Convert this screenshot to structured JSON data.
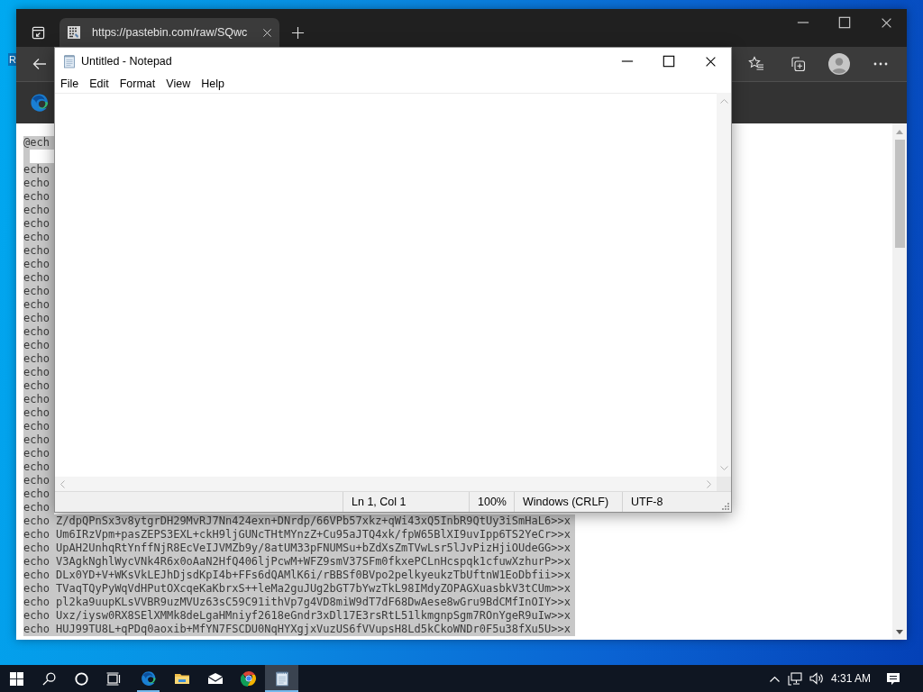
{
  "desktop": {
    "icon_labels": [
      "R"
    ]
  },
  "browser": {
    "tabs": [
      {
        "title": "https://pastebin.com/raw/SQwc",
        "selected": true
      }
    ],
    "page": {
      "selected": true,
      "first_line": "@ech",
      "lines": [
        "echo",
        "echo",
        "echo",
        "echo",
        "echo",
        "echo",
        "echo",
        "echo",
        "echo",
        "echo",
        "echo",
        "echo",
        "echo",
        "echo",
        "echo",
        "echo",
        "echo",
        "echo",
        "echo",
        "echo",
        "echo",
        "echo",
        "echo",
        "echo",
        "echo",
        "echo",
        "echo Z/dpQPnSx3v8ytgrDH29MvRJ7Nn424exn+DNrdp/66VPb57xkz+qWi43xQ5InbR9QtUy3iSmHaL6>>x",
        "echo Um6IRzVpm+pasZEPS3EXL+ckH9ljGUNcTHtMYnzZ+Cu95aJTQ4xk/fpW65BlXI9uvIpp6TS2YeCr>>x",
        "echo UpAH2UnhqRtYnffNjR8EcVeIJVMZb9y/8atUM33pFNUMSu+bZdXsZmTVwLsr5lJvPizHjiOUdeGG>>x",
        "echo V3AgkNghlWycVNk4R6x0oAaN2HfQ406ljPcwM+WFZ9smV37SFm0fkxePCLnHcspqk1cfuwXzhurP>>x",
        "echo DLx0YD+V+WKsVkLEJhDjsdKpI4b+FFs6dQAMlK6i/rBBSf0BVpo2pelkyeukzTbUftnW1EoDbfii>>x",
        "echo TVaqTQyPyWqVdHPutOXcqeKaKbrxS++leMa2guJUg2bGT7bYwzTkL98IMdyZOPAGXuasbkV3tCUm>>x",
        "echo pl2ka9uupKLsVVBR9uzMVUz63sC59C91ithVp7g4VD8miW9dT7dF68DwAese8wGru9BdCMfInOIY>>x",
        "echo Uxz/iysw0RX8SElXMMk8deLgaHMniyf2618eGndr3xDl17E3rsRtL51lkmgnpSgm7ROnYgeR9uIw>>x",
        "echo HUJ99TU8L+qPDq0aoxib+MfYN7FSCDU0NqHYXgjxVuzUS6fVVupsH8Ld5kCkoWNDr0F5u38fXu5U>>x"
      ]
    }
  },
  "notepad": {
    "title": "Untitled - Notepad",
    "menu": [
      "File",
      "Edit",
      "Format",
      "View",
      "Help"
    ],
    "status": [
      "Ln 1, Col 1",
      "100%",
      "Windows (CRLF)",
      "UTF-8"
    ]
  },
  "taskbar": {
    "apps": [
      {
        "kind": "edge",
        "running": true,
        "selected": false
      },
      {
        "kind": "explorer",
        "running": false,
        "selected": false
      },
      {
        "kind": "mail",
        "running": false,
        "selected": false
      },
      {
        "kind": "chrome",
        "running": false,
        "selected": false
      },
      {
        "kind": "notepad",
        "running": true,
        "selected": true
      }
    ],
    "clock": "4:31 AM"
  }
}
